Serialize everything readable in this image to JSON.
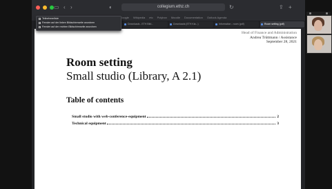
{
  "browser": {
    "address": "collegium.ethz.ch",
    "bookmarks": [
      "Google",
      "Wikipedia",
      "etc",
      "Polybox",
      "Moodle",
      "Documentation",
      "Outlook Agenda"
    ],
    "tabs": [
      {
        "label": "",
        "active": false,
        "hidden": true
      },
      {
        "label": "Recording and Video...",
        "active": false,
        "hidden": false
      },
      {
        "label": "Downloads - ETH Bibl...",
        "active": false,
        "hidden": false
      },
      {
        "label": "Downloads (ETH Kla...)",
        "active": false,
        "hidden": false
      },
      {
        "label": "Information - room (pdf)",
        "active": false,
        "hidden": false
      },
      {
        "label": "Room setting (pdf)",
        "active": true,
        "hidden": false
      }
    ],
    "menu_items": [
      "Teilnehmerliste",
      "Fenster auf der linken Bildschirmseite anordnen",
      "Fenster auf der rechten Bildschirmseite anordnen"
    ]
  },
  "document": {
    "header_lines": [
      "Head of Finance and Administration",
      "Andrea Trüttmann / Assistance",
      "September 28, 2021"
    ],
    "title": "Room setting",
    "subtitle": "Small studio (Library, A 2.1)",
    "toc_heading": "Table of contents",
    "toc": [
      {
        "label": "Small studio with web-conference-equipment",
        "page": "2"
      },
      {
        "label": "Technical equipment",
        "page": "3"
      }
    ]
  },
  "icons": {
    "sidebar": "sidebar-icon",
    "back": "back-arrow-icon",
    "forward": "forward-arrow-icon",
    "shield": "shield-icon",
    "share": "share-icon",
    "add_tab": "plus-icon"
  }
}
